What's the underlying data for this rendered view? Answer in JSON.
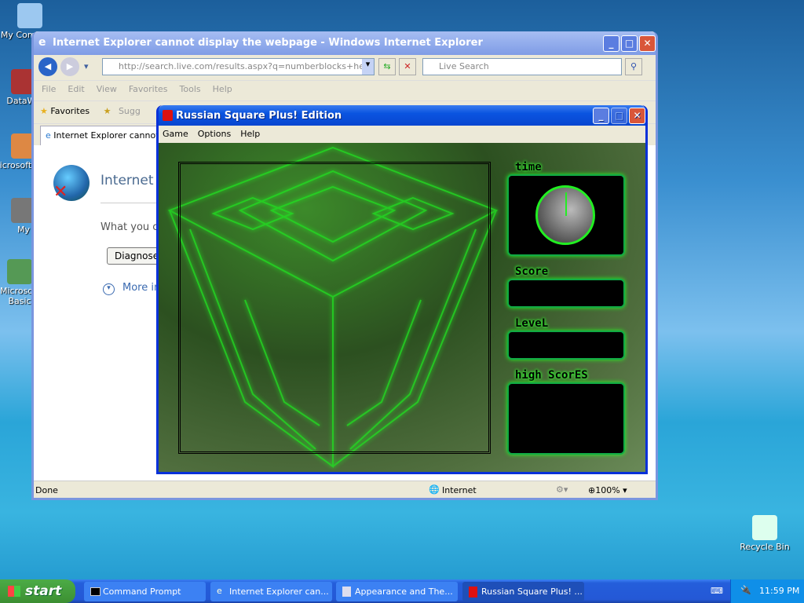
{
  "desktop": {
    "icons": [
      {
        "label": "My Computer"
      },
      {
        "label": "DataWa"
      },
      {
        "label": "Microsoft C++"
      },
      {
        "label": "My"
      },
      {
        "label": "Microsoft Basic"
      }
    ],
    "recycle_bin": "Recycle Bin"
  },
  "ie": {
    "title": "Internet Explorer cannot display the webpage - Windows Internet Explorer",
    "address": "http://search.live.com/results.aspx?q=numberblocks+hexagon",
    "search_placeholder": "Live Search",
    "menu": [
      "File",
      "Edit",
      "View",
      "Favorites",
      "Tools",
      "Help"
    ],
    "favorites": "Favorites",
    "suggested": "Sugg",
    "tab": "Internet Explorer cannot d",
    "heading": "Internet E",
    "what": "What you ca",
    "diagnose": "Diagnose",
    "more": "More in",
    "status": {
      "text": "Done",
      "zone": "Internet",
      "zoom": "100%"
    }
  },
  "game": {
    "title": "Russian Square Plus! Edition",
    "menu": [
      "Game",
      "Options",
      "Help"
    ],
    "labels": {
      "time": "time",
      "score": "Score",
      "level": "LeveL",
      "high_scores": "high ScorES"
    },
    "accent": "#22ff22"
  },
  "taskbar": {
    "start": "start",
    "items": [
      {
        "label": "Command Prompt"
      },
      {
        "label": "Internet Explorer can..."
      },
      {
        "label": "Appearance and The..."
      },
      {
        "label": "Russian Square Plus! ..."
      }
    ],
    "clock": "11:59 PM"
  }
}
